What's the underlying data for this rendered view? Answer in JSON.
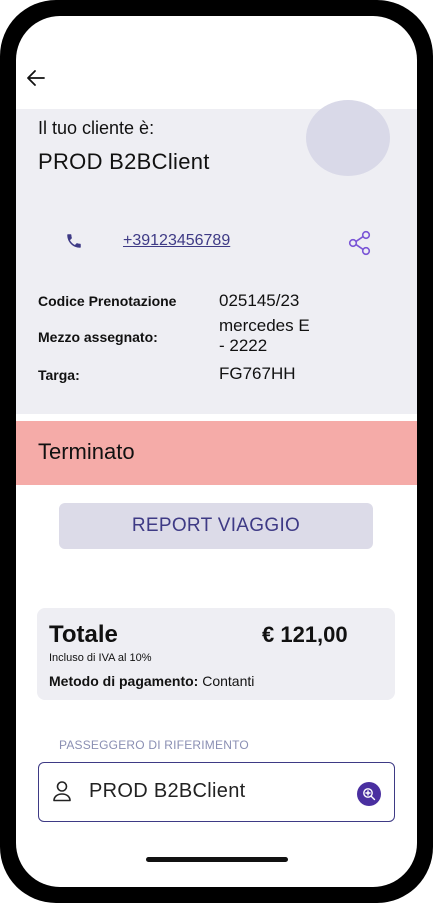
{
  "header": {
    "client_label": "Il tuo cliente è:",
    "client_name": "PROD B2BClient",
    "phone_number": "+39123456789"
  },
  "booking": {
    "rows": [
      {
        "key": "Codice Prenotazione",
        "value": "025145/23"
      },
      {
        "key": "Mezzo assegnato:",
        "value": "mercedes E\n- 2222"
      },
      {
        "key": "Targa:",
        "value": "FG767HH"
      }
    ]
  },
  "status": {
    "text": "Terminato",
    "color": "#f5aba8"
  },
  "report_button": {
    "label": "REPORT VIAGGIO"
  },
  "totals": {
    "label": "Totale",
    "amount": "€ 121,00",
    "iva_note": "Incluso di IVA al 10%",
    "payment_label": "Metodo di pagamento:",
    "payment_value": "Contanti"
  },
  "passenger": {
    "label": "PASSEGGERO DI RIFERIMENTO",
    "name": "PROD B2BClient"
  },
  "colors": {
    "accent": "#3e3a85",
    "panel": "#eeeef3",
    "search_button": "#4a2fa0"
  },
  "icons": [
    "back-arrow-icon",
    "phone-icon",
    "share-icon",
    "user-icon",
    "search-plus-icon"
  ]
}
